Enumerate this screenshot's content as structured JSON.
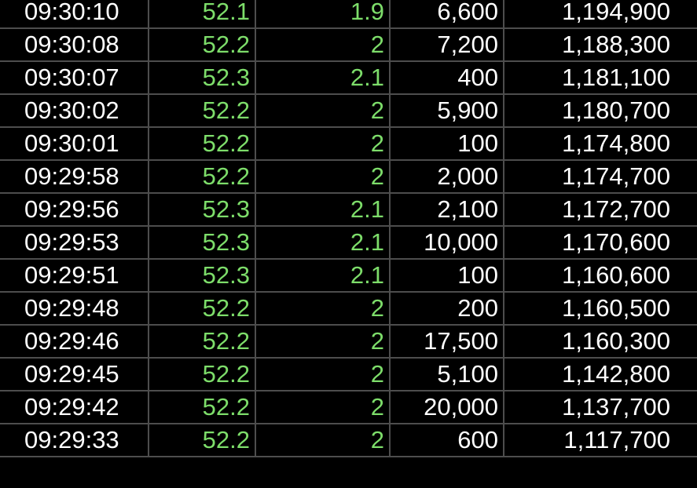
{
  "colors": {
    "background": "#000000",
    "grid": "#4d4d4d",
    "neutral_text": "#ffffff",
    "up_text": "#7ddd6a"
  },
  "ticks": [
    {
      "time": "09:30:10",
      "price": "52.1",
      "change": "1.9",
      "volume": "6,600",
      "cumulative_volume": "1,194,900"
    },
    {
      "time": "09:30:08",
      "price": "52.2",
      "change": "2",
      "volume": "7,200",
      "cumulative_volume": "1,188,300"
    },
    {
      "time": "09:30:07",
      "price": "52.3",
      "change": "2.1",
      "volume": "400",
      "cumulative_volume": "1,181,100"
    },
    {
      "time": "09:30:02",
      "price": "52.2",
      "change": "2",
      "volume": "5,900",
      "cumulative_volume": "1,180,700"
    },
    {
      "time": "09:30:01",
      "price": "52.2",
      "change": "2",
      "volume": "100",
      "cumulative_volume": "1,174,800"
    },
    {
      "time": "09:29:58",
      "price": "52.2",
      "change": "2",
      "volume": "2,000",
      "cumulative_volume": "1,174,700"
    },
    {
      "time": "09:29:56",
      "price": "52.3",
      "change": "2.1",
      "volume": "2,100",
      "cumulative_volume": "1,172,700"
    },
    {
      "time": "09:29:53",
      "price": "52.3",
      "change": "2.1",
      "volume": "10,000",
      "cumulative_volume": "1,170,600"
    },
    {
      "time": "09:29:51",
      "price": "52.3",
      "change": "2.1",
      "volume": "100",
      "cumulative_volume": "1,160,600"
    },
    {
      "time": "09:29:48",
      "price": "52.2",
      "change": "2",
      "volume": "200",
      "cumulative_volume": "1,160,500"
    },
    {
      "time": "09:29:46",
      "price": "52.2",
      "change": "2",
      "volume": "17,500",
      "cumulative_volume": "1,160,300"
    },
    {
      "time": "09:29:45",
      "price": "52.2",
      "change": "2",
      "volume": "5,100",
      "cumulative_volume": "1,142,800"
    },
    {
      "time": "09:29:42",
      "price": "52.2",
      "change": "2",
      "volume": "20,000",
      "cumulative_volume": "1,137,700"
    },
    {
      "time": "09:29:33",
      "price": "52.2",
      "change": "2",
      "volume": "600",
      "cumulative_volume": "1,117,700"
    }
  ]
}
